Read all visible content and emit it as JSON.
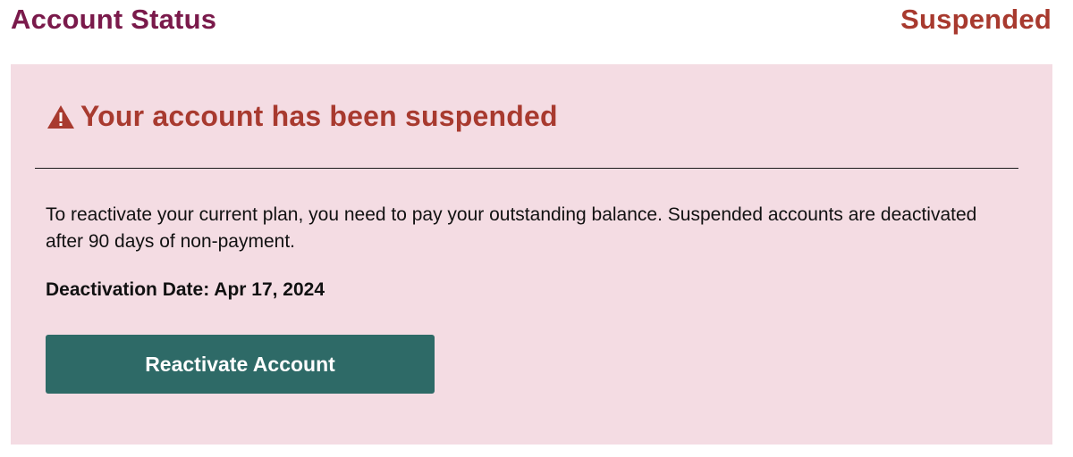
{
  "header": {
    "title": "Account Status",
    "status": "Suspended"
  },
  "alert": {
    "icon": "warning-icon",
    "title": "Your account has been suspended",
    "body": "To reactivate your current plan, you need to pay your outstanding balance. Suspended accounts are deactivated after 90 days of non-payment.",
    "deactivation_text": "Deactivation Date: Apr 17, 2024"
  },
  "actions": {
    "reactivate_label": "Reactivate Account"
  },
  "colors": {
    "title": "#7a1a4b",
    "status": "#a83a2f",
    "panel_bg": "#f4dce3",
    "button_bg": "#2e6a67"
  }
}
